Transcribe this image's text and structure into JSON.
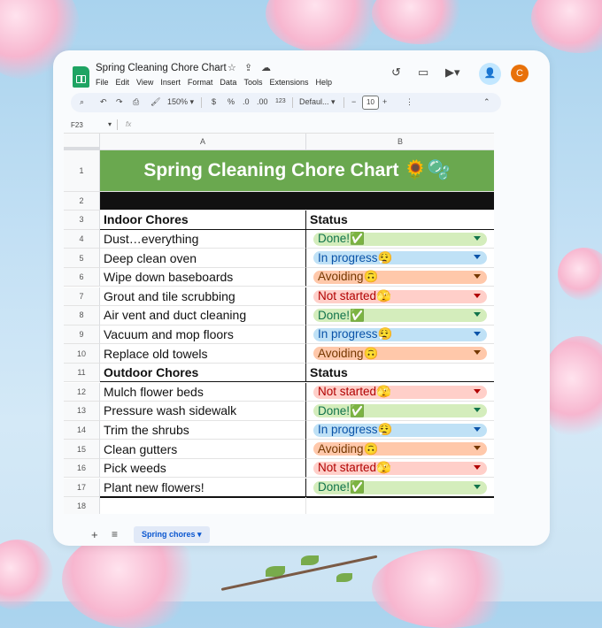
{
  "app": {
    "doc_title": "Spring Cleaning Chore Chart",
    "menu": [
      "File",
      "Edit",
      "View",
      "Insert",
      "Format",
      "Data",
      "Tools",
      "Extensions",
      "Help"
    ],
    "avatar_initial": "C",
    "icons": {
      "star": "star-icon",
      "move": "move-to-drive-icon",
      "cloud": "cloud-status-icon",
      "history": "history-icon",
      "comment": "comment-icon",
      "meet": "video-call-icon",
      "share": "share-person-icon"
    }
  },
  "toolbar": {
    "zoom": "150%",
    "currency": "$",
    "percent": "%",
    "decrease_decimals": ".0",
    "increase_decimals": ".00",
    "number_format": "123",
    "font": "Defaul...",
    "font_size": "10"
  },
  "formula": {
    "cell_ref": "F23",
    "fx": "fx"
  },
  "columns": [
    "A",
    "B"
  ],
  "sheet": {
    "title": "Spring Cleaning Chore Chart 🌻🫧",
    "indoor_header": "Indoor Chores",
    "outdoor_header": "Outdoor Chores",
    "status_header": "Status",
    "indoor": [
      {
        "row": "4",
        "chore": "Dust…everything",
        "status": "Done!✅"
      },
      {
        "row": "5",
        "chore": "Deep clean oven",
        "status": "In progress😮‍💨"
      },
      {
        "row": "6",
        "chore": "Wipe down baseboards",
        "status": "Avoiding🙃"
      },
      {
        "row": "7",
        "chore": "Grout and tile scrubbing",
        "status": "Not started🫣"
      },
      {
        "row": "8",
        "chore": "Air vent and duct cleaning",
        "status": "Done!✅"
      },
      {
        "row": "9",
        "chore": "Vacuum and mop floors",
        "status": "In progress😮‍💨"
      },
      {
        "row": "10",
        "chore": "Replace old towels",
        "status": "Avoiding🙃"
      }
    ],
    "outdoor": [
      {
        "row": "12",
        "chore": "Mulch flower beds",
        "status": "Not started🫣"
      },
      {
        "row": "13",
        "chore": "Pressure wash sidewalk",
        "status": "Done!✅"
      },
      {
        "row": "14",
        "chore": "Trim the shrubs",
        "status": "In progress😮‍💨"
      },
      {
        "row": "15",
        "chore": "Clean gutters",
        "status": "Avoiding🙃"
      },
      {
        "row": "16",
        "chore": "Pick weeds",
        "status": "Not started🫣"
      },
      {
        "row": "17",
        "chore": "Plant new flowers!",
        "status": "Done!✅"
      }
    ],
    "row_numbers": [
      "1",
      "2",
      "3",
      "11",
      "18"
    ]
  },
  "status_colors": {
    "Done": {
      "bg": "#d4edbc",
      "fg": "#11734b"
    },
    "In progress": {
      "bg": "#bfe1f6",
      "fg": "#0a53a8"
    },
    "Avoiding": {
      "bg": "#ffc8aa",
      "fg": "#753800"
    },
    "Not started": {
      "bg": "#ffcfc9",
      "fg": "#b10202"
    }
  },
  "tab": {
    "label": "Spring chores"
  }
}
